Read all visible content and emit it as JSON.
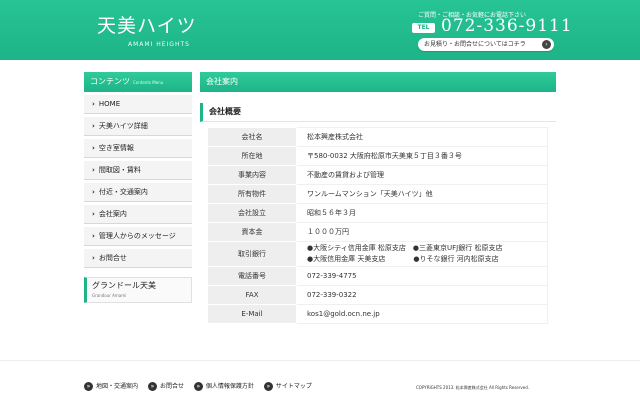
{
  "header": {
    "logo_main": "天美ハイツ",
    "logo_sub": "AMAMI HEIGHTS",
    "tagline": "ご質問・ご相談・お気軽にお電話下さい",
    "tel_label": "TEL",
    "tel_number": "072-336-9111",
    "inquiry_label": "お見積り・お問合せについてはコチラ",
    "accent": "#1db487"
  },
  "sidebar": {
    "title": "コンテンツ",
    "title_en": "Contents Menu",
    "items": [
      "HOME",
      "天美ハイツ詳細",
      "空き室情報",
      "間取図・賃料",
      "付近・交通案内",
      "会社案内",
      "管理人からのメッセージ",
      "お問合せ"
    ],
    "banner_title": "グランドール天美",
    "banner_sub": "Grandour Amami"
  },
  "main": {
    "page_title": "会社案内",
    "section_heading": "会社概要",
    "rows": [
      {
        "label": "会社名",
        "value": "松本興産株式会社"
      },
      {
        "label": "所在地",
        "value": "〒580-0032 大阪府松原市天美東５丁目３番３号"
      },
      {
        "label": "事業内容",
        "value": "不動産の賃貸および管理"
      },
      {
        "label": "所有物件",
        "value": "ワンルームマンション「天美ハイツ」他"
      },
      {
        "label": "会社設立",
        "value": "昭和５６年３月"
      },
      {
        "label": "資本金",
        "value": "１０００万円"
      },
      {
        "label": "電話番号",
        "value": "072-339-4775"
      },
      {
        "label": "FAX",
        "value": "072-339-0322"
      },
      {
        "label": "E-Mail",
        "value": "kos1@gold.ocn.ne.jp"
      }
    ],
    "banks": {
      "label": "取引銀行",
      "line1": "●大阪シティ信用金庫 松原支店　●三菱東京UFJ銀行 松原支店",
      "line2": "●大阪信用金庫 天美支店　　　　●りそな銀行 河内松原支店"
    }
  },
  "footer": {
    "links": [
      "地図・交通案内",
      "お問合せ",
      "個人情報保護方針",
      "サイトマップ"
    ],
    "copyright": "COPYRIGHTS 2013. 松本興産株式会社 All Rights Reserved."
  }
}
